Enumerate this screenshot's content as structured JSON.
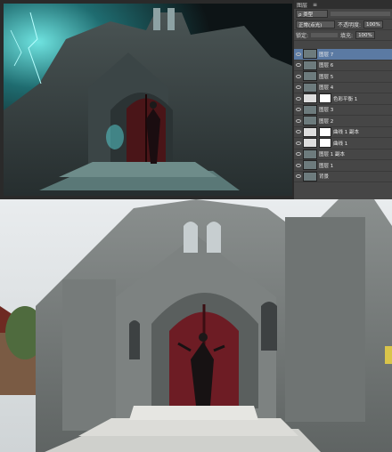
{
  "layers_panel": {
    "tabs": [
      "图层",
      "≡"
    ],
    "kind_filter": "ρ 类型",
    "blend_mode": "正常(点光)",
    "opacity_label": "不透明度:",
    "opacity_value": "100%",
    "lock_label": "锁定:",
    "fill_label": "填充:",
    "fill_value": "100%",
    "layers": [
      {
        "name": "图层 7",
        "selected": true,
        "type": "pixel"
      },
      {
        "name": "图层 6",
        "selected": false,
        "type": "pixel"
      },
      {
        "name": "图层 5",
        "selected": false,
        "type": "pixel"
      },
      {
        "name": "图层 4",
        "selected": false,
        "type": "pixel"
      },
      {
        "name": "色彩平衡 1",
        "selected": false,
        "type": "adjustment"
      },
      {
        "name": "图层 3",
        "selected": false,
        "type": "pixel"
      },
      {
        "name": "图层 2",
        "selected": false,
        "type": "pixel"
      },
      {
        "name": "曲线 1 副本",
        "selected": false,
        "type": "adjustment"
      },
      {
        "name": "曲线 1",
        "selected": false,
        "type": "adjustment"
      },
      {
        "name": "图层 1 副本",
        "selected": false,
        "type": "pixel"
      },
      {
        "name": "图层 1",
        "selected": false,
        "type": "pixel"
      },
      {
        "name": "背景",
        "selected": false,
        "type": "pixel"
      }
    ]
  },
  "colors": {
    "panel_bg": "#464646",
    "selected_layer": "#5b7aa3",
    "teal_glow": "#2fb6b8",
    "door_red": "#6a1a22"
  }
}
